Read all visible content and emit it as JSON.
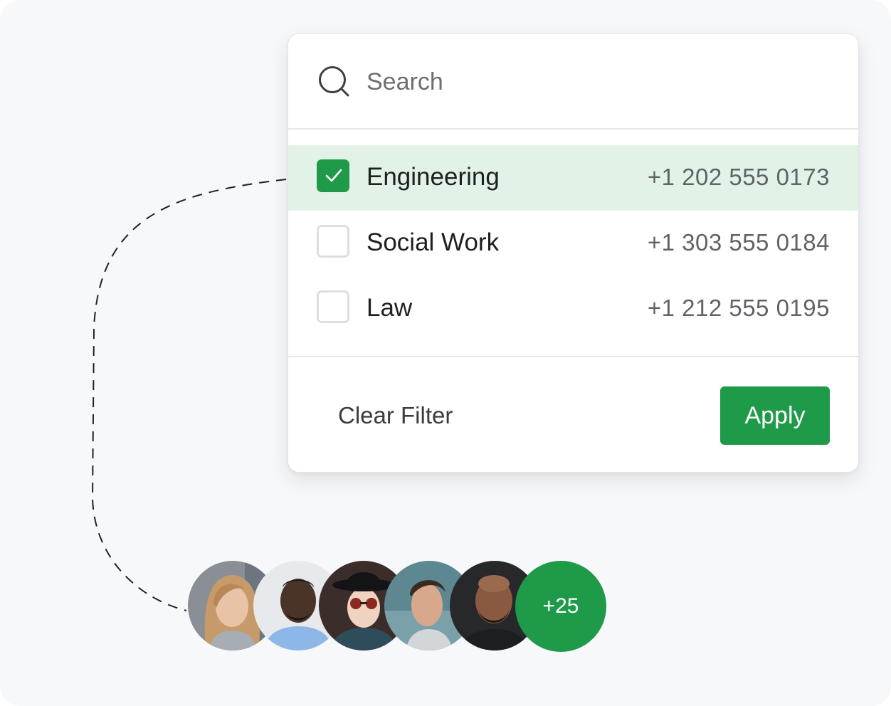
{
  "search": {
    "placeholder": "Search",
    "icon": "search-icon"
  },
  "departments": [
    {
      "label": "Engineering",
      "phone": "+1 202 555 0173",
      "checked": true
    },
    {
      "label": "Social Work",
      "phone": "+1 303 555 0184",
      "checked": false
    },
    {
      "label": "Law",
      "phone": "+1 212 555 0195",
      "checked": false
    }
  ],
  "footer": {
    "clear_label": "Clear Filter",
    "apply_label": "Apply"
  },
  "avatars": {
    "count": 5,
    "more_label": "+25"
  },
  "colors": {
    "accent": "#1e9a48",
    "selected_row": "#e3f2e6",
    "background": "#f7f8fa"
  }
}
